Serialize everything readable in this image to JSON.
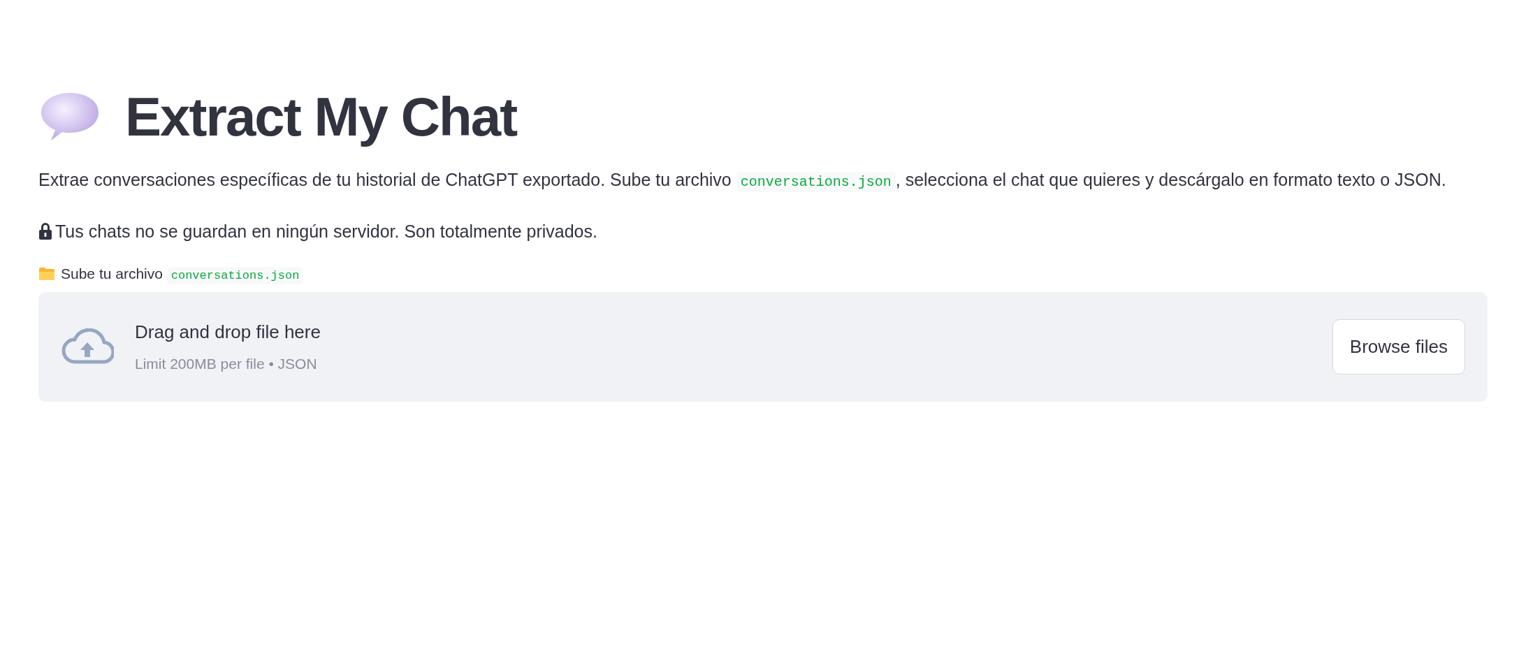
{
  "title": "Extract My Chat",
  "intro": {
    "before": "Extrae conversaciones específicas de tu historial de ChatGPT exportado. Sube tu archivo ",
    "code": "conversations.json",
    "after": ", selecciona el chat que quieres y descárgalo en formato texto o JSON."
  },
  "privacy_note": "Tus chats no se guardan en ningún servidor. Son totalmente privados.",
  "uploader": {
    "label": "Sube tu archivo ",
    "label_code": "conversations.json",
    "drop_text": "Drag and drop file here",
    "limit_text": "Limit 200MB per file • JSON",
    "button": "Browse files"
  }
}
